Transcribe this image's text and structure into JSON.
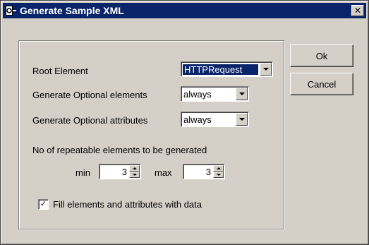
{
  "window": {
    "title": "Generate Sample XML",
    "close_glyph": "✕",
    "icon": "app-icon",
    "colors": {
      "titlebar": "#0a246a",
      "face": "#d4d0c8",
      "selection": "#0a246a"
    }
  },
  "buttons": {
    "ok_label": "Ok",
    "cancel_label": "Cancel"
  },
  "form": {
    "root_element_label": "Root Element",
    "root_element_value": "HTTPRequest",
    "optional_elements_label": "Generate Optional elements",
    "optional_elements_value": "always",
    "optional_attributes_label": "Generate Optional attributes",
    "optional_attributes_value": "always",
    "repeatable_label": "No of repeatable elements to be generated",
    "min_label": "min",
    "min_value": "3",
    "max_label": "max",
    "max_value": "3",
    "fill_data_label": "Fill elements and attributes with data",
    "fill_data_checked": true,
    "check_glyph": "✓"
  }
}
